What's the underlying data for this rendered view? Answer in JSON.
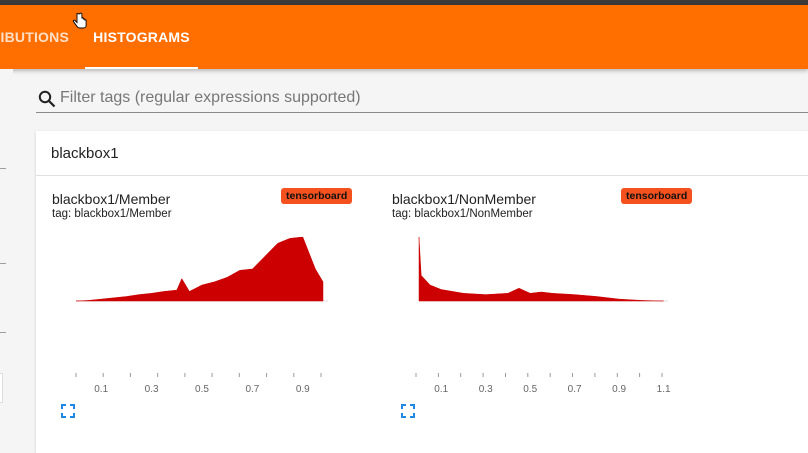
{
  "tabs": [
    {
      "label": "DISTRIBUTIONS",
      "shown": "RIBUTIONS"
    },
    {
      "label": "HISTOGRAMS"
    }
  ],
  "search": {
    "placeholder": "Filter tags (regular expressions supported)"
  },
  "category": {
    "title": "blackbox1"
  },
  "colors": {
    "accent": "#ff6f00",
    "histogram": "#cc0000",
    "badge": "#f4511e"
  },
  "cards": [
    {
      "title": "blackbox1/Member",
      "tag": "tag: blackbox1/Member",
      "run": "tensorboard",
      "icon": "fullscreen-icon"
    },
    {
      "title": "blackbox1/NonMember",
      "tag": "tag: blackbox1/NonMember",
      "run": "tensorboard",
      "icon": "fullscreen-icon"
    }
  ],
  "chart_data": [
    {
      "type": "area",
      "title": "blackbox1/Member",
      "x": [
        0.0,
        0.05,
        0.1,
        0.15,
        0.2,
        0.25,
        0.3,
        0.35,
        0.4,
        0.42,
        0.45,
        0.5,
        0.55,
        0.6,
        0.65,
        0.7,
        0.75,
        0.8,
        0.83,
        0.85,
        0.9,
        0.95,
        0.98
      ],
      "values": [
        0.0,
        0.01,
        0.03,
        0.05,
        0.07,
        0.1,
        0.12,
        0.15,
        0.17,
        0.35,
        0.15,
        0.25,
        0.3,
        0.37,
        0.48,
        0.5,
        0.7,
        0.9,
        0.95,
        0.98,
        1.0,
        0.5,
        0.3
      ],
      "xticks": [
        "0.1",
        "0.3",
        "0.5",
        "0.7",
        "0.9"
      ],
      "xlim": [
        0.0,
        1.0
      ]
    },
    {
      "type": "area",
      "title": "blackbox1/NonMember",
      "x": [
        0.0,
        0.01,
        0.05,
        0.1,
        0.2,
        0.3,
        0.4,
        0.45,
        0.5,
        0.55,
        0.6,
        0.7,
        0.8,
        0.9,
        1.0,
        1.1
      ],
      "values": [
        1.0,
        0.4,
        0.25,
        0.18,
        0.12,
        0.1,
        0.12,
        0.2,
        0.12,
        0.14,
        0.12,
        0.1,
        0.07,
        0.03,
        0.01,
        0.0
      ],
      "xticks": [
        "0.1",
        "0.3",
        "0.5",
        "0.7",
        "0.9",
        "1.1"
      ],
      "xlim": [
        0.0,
        1.12
      ]
    }
  ]
}
